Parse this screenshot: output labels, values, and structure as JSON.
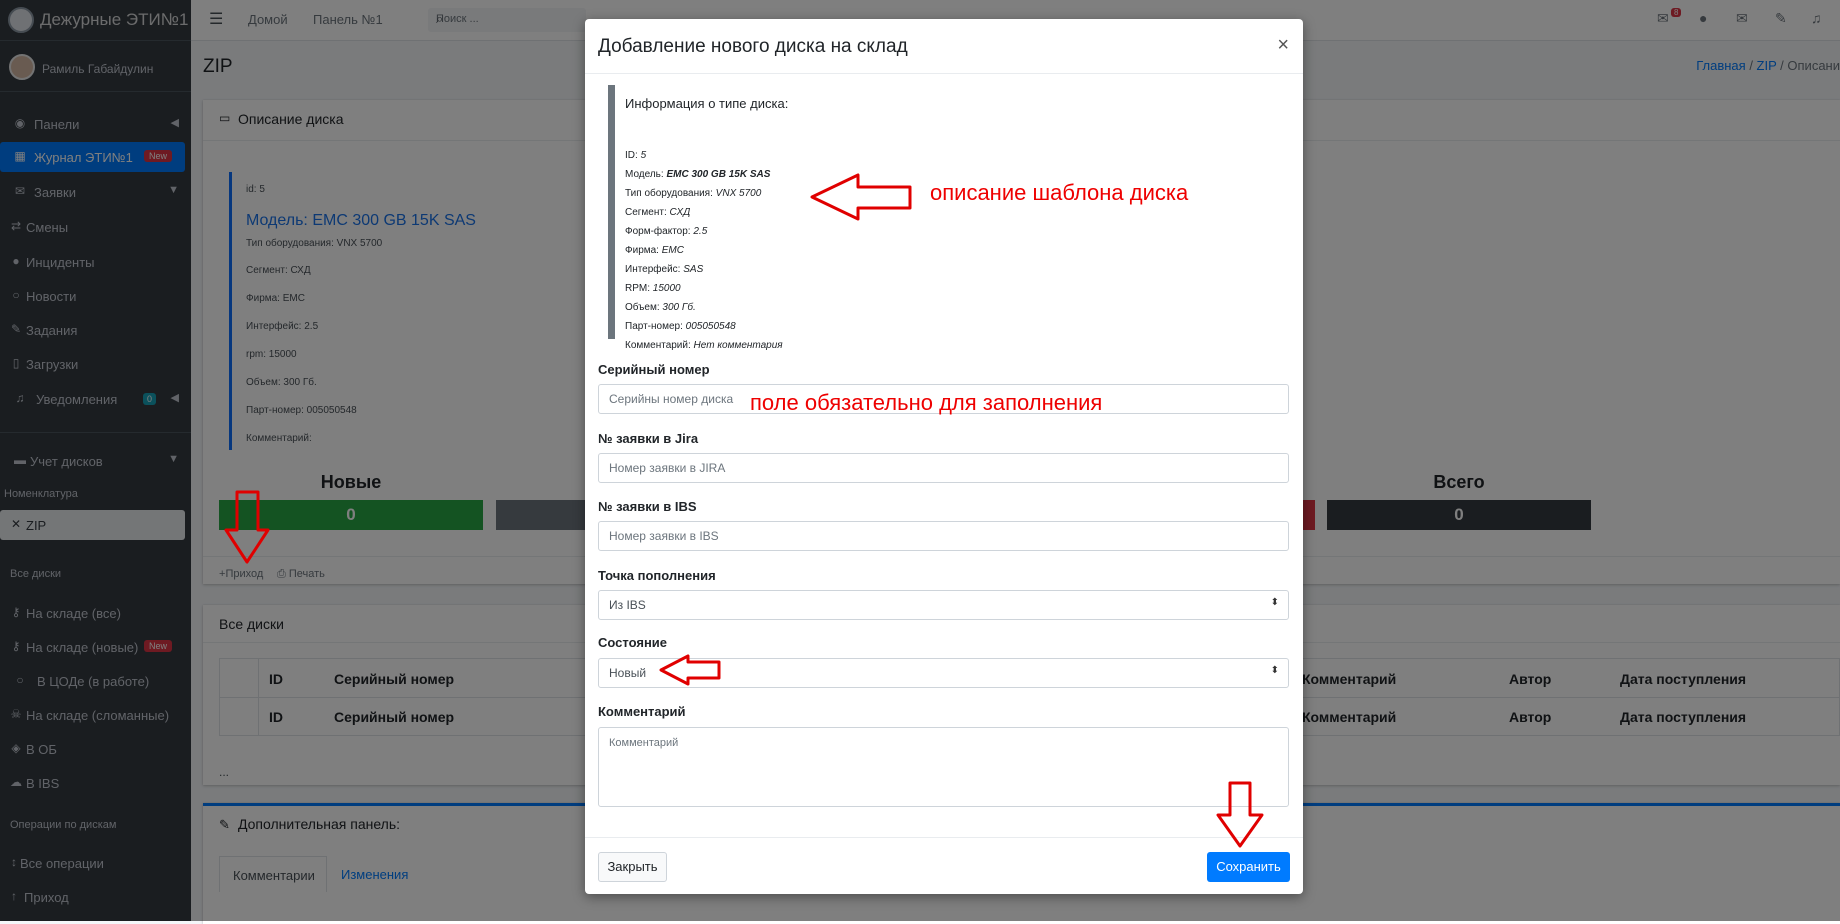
{
  "brand": {
    "title": "Дежурные ЭТИ№1"
  },
  "user": {
    "name": "Рамиль Габайдулин"
  },
  "sidebar": {
    "items": [
      {
        "label": "Панели",
        "icon": "gauge-icon"
      },
      {
        "label": "Журнал ЭТИ№1",
        "icon": "grid-icon",
        "badge": "New"
      },
      {
        "label": "Заявки",
        "icon": "envelope-icon"
      },
      {
        "label": "Смены",
        "icon": "exchange-icon"
      },
      {
        "label": "Инциденты",
        "icon": "alert-icon"
      },
      {
        "label": "Новости",
        "icon": "chat-icon"
      },
      {
        "label": "Задания",
        "icon": "wrench-icon"
      },
      {
        "label": "Загрузки",
        "icon": "file-icon"
      },
      {
        "label": "Уведомления",
        "icon": "bell-icon",
        "badge": "0"
      }
    ],
    "disk_section": "Учет дисков",
    "nomenclature": "Номенклатура",
    "zip": "ZIP",
    "all_disks_header": "Все диски",
    "disk_items": [
      {
        "label": "На складе (все)",
        "icon": "key-icon"
      },
      {
        "label": "На складе (новые)",
        "icon": "key-icon",
        "badge": "New"
      },
      {
        "label": "В ЦОДе (в работе)",
        "icon": "circle-icon"
      },
      {
        "label": "На складе (сломанные)",
        "icon": "skull-icon"
      },
      {
        "label": "В ОБ",
        "icon": "shield-icon"
      },
      {
        "label": "В IBS",
        "icon": "cloud-icon"
      }
    ],
    "ops_header": "Операции по дискам",
    "ops_items": [
      {
        "label": "Все операции",
        "icon": "updown-icon"
      },
      {
        "label": "Приход",
        "icon": "arrow-up-icon"
      }
    ]
  },
  "topbar": {
    "home": "Домой",
    "panel": "Панель №1",
    "search_placeholder": "Поиск ...",
    "mail_badge": "8"
  },
  "page": {
    "title": "ZIP",
    "breadcrumb": {
      "home": "Главная",
      "zip": "ZIP",
      "current": "Описани"
    },
    "desc_card_title": "Описание диска",
    "desc": {
      "id": "id: 5",
      "model": "Модель: EMC 300 GB 15K SAS",
      "type": "Тип оборудования: VNX 5700",
      "segment": "Сегмент: СХД",
      "firm": "Фирма: EMC",
      "interface": "Интерфейс: 2.5",
      "rpm": "rpm: 15000",
      "volume": "Объем: 300 Гб.",
      "part": "Парт-номер: 005050548",
      "comment": "Комментарий:"
    },
    "stats": {
      "new_label": "Новые",
      "new_value": "0",
      "total_label": "Всего",
      "total_value": "0"
    },
    "actions": {
      "income": "Приход",
      "print": "Печать"
    },
    "all_disks_title": "Все диски",
    "table_headers": [
      "ID",
      "Серийный номер",
      "Комментарий",
      "Автор",
      "Дата поступления"
    ],
    "ellipsis": "...",
    "extra_panel": "Дополнительная панель:",
    "tabs": [
      "Комментарии",
      "Изменения"
    ]
  },
  "modal": {
    "title": "Добавление нового диска на склад",
    "info_title": "Информация о типе диска:",
    "info": [
      {
        "k": "ID:",
        "v": "5"
      },
      {
        "k": "Модель:",
        "v": "EMC 300 GB 15K SAS"
      },
      {
        "k": "Тип оборудования:",
        "v": "VNX 5700"
      },
      {
        "k": "Сегмент:",
        "v": "СХД"
      },
      {
        "k": "Форм-фактор:",
        "v": "2.5"
      },
      {
        "k": "Фирма:",
        "v": "EMC"
      },
      {
        "k": "Интерфейс:",
        "v": "SAS"
      },
      {
        "k": "RPM:",
        "v": "15000"
      },
      {
        "k": "Объем:",
        "v": "300 Гб."
      },
      {
        "k": "Парт-номер:",
        "v": "005050548"
      },
      {
        "k": "Комментарий:",
        "v": "Нет комментария"
      }
    ],
    "serial_label": "Серийный номер",
    "serial_placeholder": "Серийны номер диска",
    "jira_label": "№ заявки в Jira",
    "jira_placeholder": "Номер заявки в JIRA",
    "ibs_label": "№ заявки в IBS",
    "ibs_placeholder": "Номер заявки в IBS",
    "point_label": "Точка пополнения",
    "point_value": "Из IBS",
    "state_label": "Состояние",
    "state_value": "Новый",
    "comment_label": "Комментарий",
    "comment_placeholder": "Комментарий",
    "close_button": "Закрыть",
    "save_button": "Сохранить"
  },
  "annotations": {
    "template_note": "описание шаблона диска",
    "required_note": "поле обязательно для заполнения",
    "arrow_color": "#e00000"
  }
}
